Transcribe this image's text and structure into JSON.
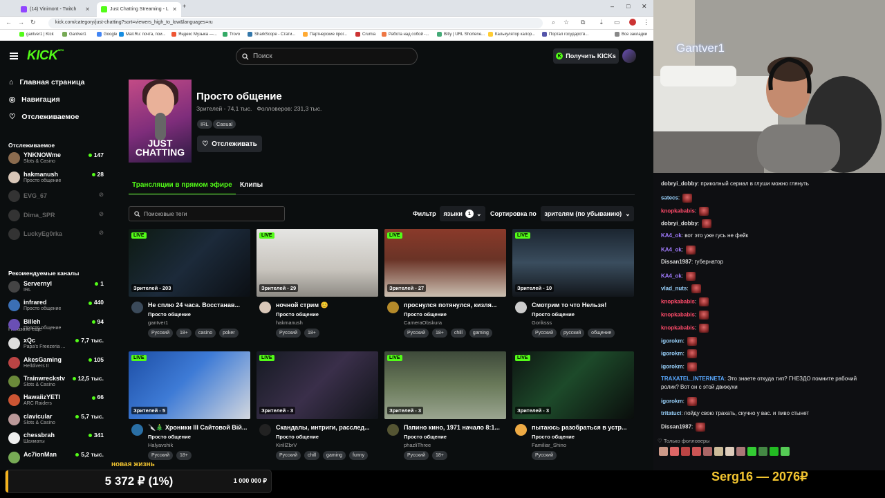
{
  "browser": {
    "tabs": [
      {
        "title": "(14) Vinimont - Twitch"
      },
      {
        "title": "Just Chatting Streaming - L"
      }
    ],
    "url": "kick.com/category/just-chatting?sort=viewers_high_to_low&languages=ru",
    "bookmarks": [
      "gantver1 | Kick",
      "Gantver1",
      "Google",
      "Mail.Ru: почта, пои...",
      "Яндекс Музыка —...",
      "Trovo",
      "SharkScope - Стати...",
      "Партнерские прог...",
      "Crumia",
      "Работа над собой -...",
      "Bitly | URL Shortene...",
      "Калькулятор калор...",
      "Портал государств...",
      "Все закладки"
    ]
  },
  "header": {
    "logo": "KICK",
    "logo_sup": "BETA",
    "search_placeholder": "Поиск",
    "get_kicks": "Получить KICKs"
  },
  "sidebar": {
    "nav": [
      {
        "label": "Главная страница",
        "icon": "home-icon"
      },
      {
        "label": "Навигация",
        "icon": "compass-icon"
      },
      {
        "label": "Отслеживаемое",
        "icon": "heart-icon"
      }
    ],
    "following_title": "Отслеживаемое",
    "following": [
      {
        "name": "YNKNOWme",
        "cat": "Slots & Casino",
        "viewers": "147",
        "online": true,
        "color": "#8b6b4e"
      },
      {
        "name": "hakmanush",
        "cat": "Просто общение",
        "viewers": "28",
        "online": true,
        "color": "#d9c7b8"
      },
      {
        "name": "EVG_67",
        "cat": "",
        "viewers": "",
        "online": false,
        "color": "#333"
      },
      {
        "name": "Dima_SPR",
        "cat": "",
        "viewers": "",
        "online": false,
        "color": "#333"
      },
      {
        "name": "LuckyEg0rka",
        "cat": "",
        "viewers": "",
        "online": false,
        "color": "#333"
      }
    ],
    "show_more": "Показать еще",
    "recommended_title": "Рекомендуемые каналы",
    "recommended": [
      {
        "name": "Servernyl",
        "cat": "IRL",
        "viewers": "1",
        "color": "#444"
      },
      {
        "name": "infrared",
        "cat": "Просто общение",
        "viewers": "440",
        "color": "#3b6fb5"
      },
      {
        "name": "Billeh",
        "cat": "Просто общение",
        "viewers": "94",
        "color": "#6a4fb5"
      },
      {
        "name": "xQc",
        "cat": "Papa's Freezeria ...",
        "viewers": "7,7 тыс.",
        "color": "#ddd"
      },
      {
        "name": "AkesGaming",
        "cat": "Helldivers II",
        "viewers": "105",
        "color": "#b44"
      },
      {
        "name": "Trainwreckstv",
        "cat": "Slots & Casino",
        "viewers": "12,5 тыс.",
        "color": "#6b8a3a"
      },
      {
        "name": "HawaiizYETI",
        "cat": "ARC Raiders",
        "viewers": "66",
        "color": "#c53"
      },
      {
        "name": "clavicular",
        "cat": "Slots & Casino",
        "viewers": "5,7 тыс.",
        "color": "#b99"
      },
      {
        "name": "chessbrah",
        "cat": "Шахматы",
        "viewers": "341",
        "color": "#eee"
      },
      {
        "name": "Ac7ionMan",
        "cat": "",
        "viewers": "5,2 тыс.",
        "color": "#7a5"
      }
    ]
  },
  "category": {
    "image_title": "JUST CHATTING",
    "title": "Просто общение",
    "viewers": "Зрителей - 74,1 тыс.",
    "followers": "Фолловеров: 231,3 тыс.",
    "tags": [
      "IRL",
      "Casual"
    ],
    "follow_label": "Отслеживать"
  },
  "tabs": {
    "live": "Трансляции в прямом эфире",
    "clips": "Клипы"
  },
  "filters": {
    "tag_search_placeholder": "Поисковые теги",
    "filter_label": "Фильтр",
    "languages": "языки",
    "languages_count": "1",
    "sort_label": "Сортировка по",
    "sort_value": "зрителям (по убыванию)"
  },
  "live_badge": "LIVE",
  "streams": [
    {
      "viewers": "Зрителей - 203",
      "title": "Не сплю 24 часа. Восстанав...",
      "category": "Просто общение",
      "channel": "gantver1",
      "tags": [
        "Русский",
        "18+",
        "casino",
        "poker"
      ],
      "thumb": "linear-gradient(135deg,#0d1a12,#1c2a3a 50%,#0b0f14)",
      "avatar": "#3b4a5a"
    },
    {
      "viewers": "Зрителей - 29",
      "title": "ночной стрим 😊",
      "category": "Просто общение",
      "channel": "hakmanush",
      "tags": [
        "Русский",
        "18+"
      ],
      "thumb": "linear-gradient(180deg,#e5e5e3,#c8c4bd 60%,#8d8a84)",
      "avatar": "#d9c7b8"
    },
    {
      "viewers": "Зрителей - 27",
      "title": "проснулся потянулся, кизля...",
      "category": "Просто общение",
      "channel": "CameraObskura",
      "tags": [
        "Русский",
        "18+",
        "chill",
        "gaming"
      ],
      "thumb": "linear-gradient(180deg,#8a3a2a,#6a3326 45%,#cbbfb1)",
      "avatar": "#b58a2a"
    },
    {
      "viewers": "Зрителей - 10",
      "title": "Смотрим то что Нельзя!",
      "category": "Просто общение",
      "channel": "Goriksss",
      "tags": [
        "Русский",
        "русский",
        "общение"
      ],
      "thumb": "linear-gradient(180deg,#1b2530,#3a4d5e 50%,#12161b)",
      "avatar": "#ccc"
    },
    {
      "viewers": "Зрителей - 5",
      "title": "🔪🎄 Хроники III Сайтовой Вій...",
      "category": "Просто общение",
      "channel": "Halyavshik",
      "tags": [
        "Русский",
        "18+"
      ],
      "thumb": "linear-gradient(135deg,#1d4ea5,#3e7bd6 45%,#d3d7de)",
      "avatar": "#2a6fa5"
    },
    {
      "viewers": "Зрителей - 3",
      "title": "Скандалы, интриги, расслед...",
      "category": "Просто общение",
      "channel": "KirillZbrV",
      "tags": [
        "Русский",
        "chill",
        "gaming",
        "funny"
      ],
      "thumb": "linear-gradient(135deg,#151a22,#3a2f4a 50%,#101318)",
      "avatar": "#222"
    },
    {
      "viewers": "Зрителей - 3",
      "title": "Папино кино, 1971 начало 8:1...",
      "category": "Просто общение",
      "channel": "phazliThree",
      "tags": [
        "Русский",
        "18+"
      ],
      "thumb": "linear-gradient(180deg,#3e4a3a,#6a7a5a 50%,#9aa590)",
      "avatar": "#553"
    },
    {
      "viewers": "Зрителей - 3",
      "title": "пытаюсь разобраться в устр...",
      "category": "Просто общение",
      "channel": "Familiar_Shino",
      "tags": [
        "Русский"
      ],
      "thumb": "linear-gradient(135deg,#0e1612,#1d4a2a 45%,#0a0d0c)",
      "avatar": "#ea4"
    }
  ],
  "webcam": {
    "overlay_name": "Gantver1"
  },
  "chat": {
    "messages": [
      {
        "user": "dobryi_dobby",
        "color": "#ddd",
        "text": "приколный сериал в глуши можно глянуть",
        "emotes": 0
      },
      {
        "user": "satecs",
        "color": "#9bd4ff",
        "text": "",
        "emotes": 1
      },
      {
        "user": "knopkababis",
        "color": "#ff4b6a",
        "text": "",
        "emotes": 1
      },
      {
        "user": "dobryi_dobby",
        "color": "#ddd",
        "text": "",
        "emotes": 1
      },
      {
        "user": "KA4_ok",
        "color": "#a27cff",
        "text": "вот это уже гусь не фейк",
        "emotes": 0
      },
      {
        "user": "KA4_ok",
        "color": "#a27cff",
        "text": "",
        "emotes": 1
      },
      {
        "user": "Dissan1987",
        "color": "#ddd",
        "text": "губернатор",
        "emotes": 0
      },
      {
        "user": "KA4_ok",
        "color": "#a27cff",
        "text": "",
        "emotes": 1
      },
      {
        "user": "vlad_nuts",
        "color": "#9bd4ff",
        "text": "",
        "emotes": 1
      },
      {
        "user": "knopkababis",
        "color": "#ff4b6a",
        "text": "",
        "emotes": 1
      },
      {
        "user": "knopkababis",
        "color": "#ff4b6a",
        "text": "",
        "emotes": 1
      },
      {
        "user": "knopkababis",
        "color": "#ff4b6a",
        "text": "",
        "emotes": 1
      },
      {
        "user": "igorokm",
        "color": "#9bd4ff",
        "text": "",
        "emotes": 1
      },
      {
        "user": "igorokm",
        "color": "#9bd4ff",
        "text": "",
        "emotes": 1
      },
      {
        "user": "igorokm",
        "color": "#9bd4ff",
        "text": "",
        "emotes": 1
      },
      {
        "user": "TRAXATEL_INTERNETA",
        "color": "#5aa9ff",
        "text": "Это знаете откуда тип? ГНЕЗДО помните рабочий",
        "text2": "ролик? Вот он с этой движухи",
        "emotes": 0
      },
      {
        "user": "igorokm",
        "color": "#9bd4ff",
        "text": "",
        "emotes": 1
      },
      {
        "user": "tritatuci",
        "color": "#9bd4ff",
        "text": "пойду свою трахать, скучно у вас. и пиво стынет",
        "emotes": 0
      },
      {
        "user": "Dissan1987",
        "color": "#ddd",
        "text": "",
        "emotes": 1
      }
    ],
    "followers_only": "Только фолловеры"
  },
  "donation": {
    "title": "новая жизнь",
    "amount": "5 372 ₽ (1%)",
    "goal": "1 000 000 ₽",
    "progress": 0.01,
    "color": "#f3b21c"
  },
  "top_donor": "Serg16 — 2076₽"
}
